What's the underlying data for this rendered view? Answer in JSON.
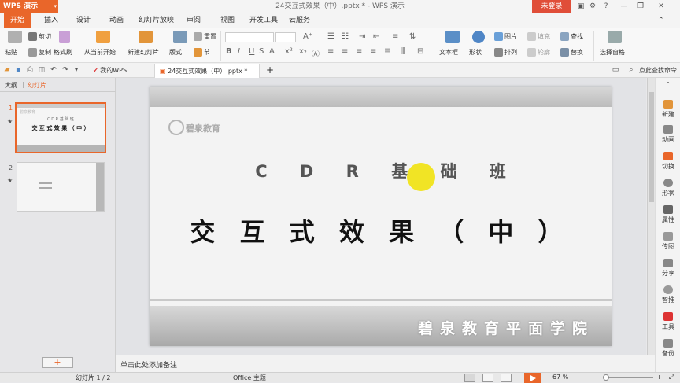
{
  "app": {
    "button_label": "WPS 演示",
    "window_title": "24交互式效果（中）.pptx * - WPS 演示",
    "login_label": "未登录"
  },
  "menu": [
    "开始",
    "插入",
    "设计",
    "动画",
    "幻灯片放映",
    "审阅",
    "视图",
    "开发工具",
    "云服务"
  ],
  "ribbon": {
    "paste": "粘贴",
    "cut": "剪切",
    "copy": "复制",
    "format_painter": "格式刷",
    "from_current": "从当前开始",
    "new_slide": "新建幻灯片",
    "layout": "版式",
    "reset": "重置",
    "section": "节",
    "textbox": "文本框",
    "shape": "形状",
    "picture": "图片",
    "fill": "填充",
    "arrange": "排列",
    "outline": "轮廓",
    "find": "查找",
    "replace": "替换",
    "select_pane": "选择窗格"
  },
  "tabs": {
    "my_wps": "我的WPS",
    "document": "24交互式效果（中）.pptx *",
    "add": "+",
    "command": "点此查找命令"
  },
  "left_panel": {
    "outline_tab": "大纲",
    "slides_tab": "幻灯片",
    "thumb1_num": "1",
    "thumb1_sub": "C D R 基 础 班",
    "thumb1_title": "交 互 式 效 果 （ 中 ）",
    "thumb2_num": "2",
    "add_slide": "+"
  },
  "slide": {
    "logo_text": "碧泉教育",
    "subtitle": "C D R 基 础 班",
    "title": "交 互 式 效 果 （ 中 ）",
    "footer": "碧泉教育平面学院"
  },
  "right_bar": [
    "新建",
    "动画",
    "切换",
    "形状",
    "属性",
    "传图",
    "分享",
    "智推",
    "工具",
    "备份"
  ],
  "notes_placeholder": "单击此处添加备注",
  "status": {
    "slide_count": "幻灯片 1 / 2",
    "theme": "Office 主题",
    "zoom": "67 %"
  },
  "colors": {
    "accent": "#e9662a",
    "login": "#e04e39"
  }
}
